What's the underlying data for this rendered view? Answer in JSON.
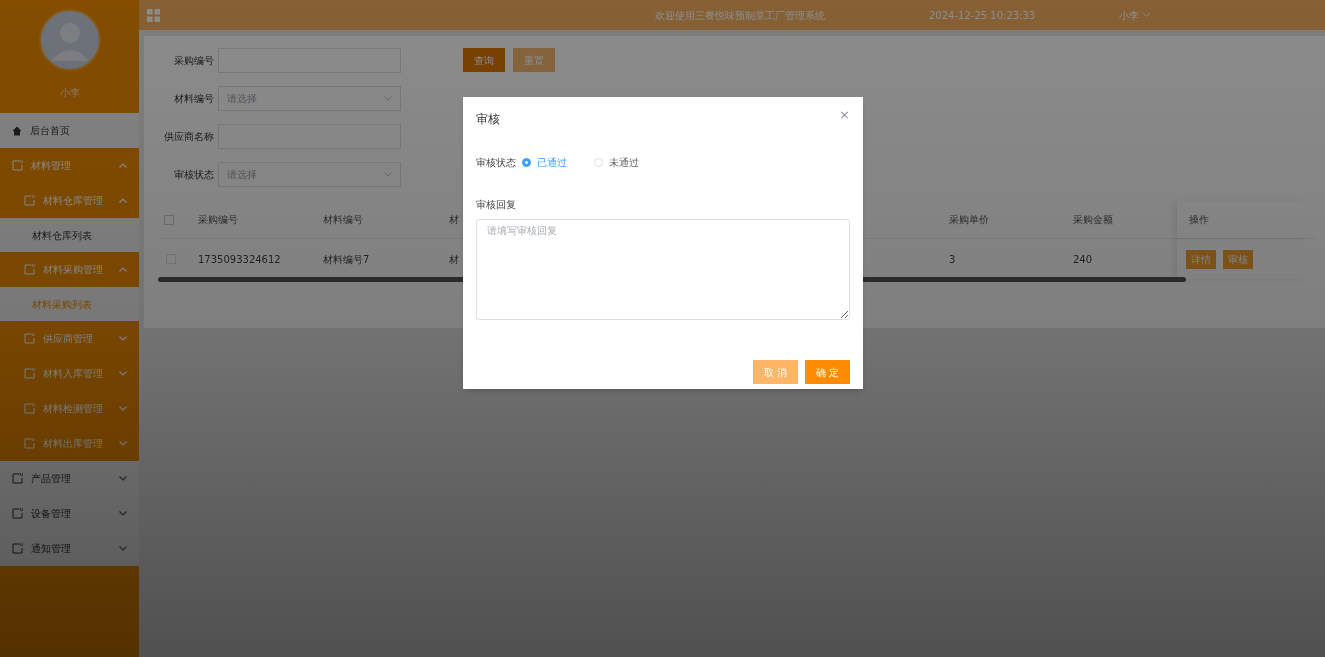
{
  "header": {
    "title": "欢迎使用三餐悦味预制菜工厂管理系统",
    "datetime": "2024-12-25 10:23:33",
    "user": "小李"
  },
  "sidebar": {
    "user_name": "小李",
    "items": [
      {
        "kind": "home",
        "label": "后台首页",
        "selected": false
      },
      {
        "kind": "group",
        "label": "材料管理",
        "expanded": true,
        "children": [
          {
            "kind": "group",
            "label": "材料仓库管理",
            "expanded": true,
            "children": [
              {
                "kind": "leaf",
                "label": "材料仓库列表",
                "selected": false
              }
            ]
          },
          {
            "kind": "group",
            "label": "材料采购管理",
            "expanded": true,
            "children": [
              {
                "kind": "leaf",
                "label": "材料采购列表",
                "selected": true
              }
            ]
          },
          {
            "kind": "group",
            "label": "供应商管理",
            "expanded": false
          },
          {
            "kind": "group",
            "label": "材料入库管理",
            "expanded": false
          },
          {
            "kind": "group",
            "label": "材料检测管理",
            "expanded": false
          },
          {
            "kind": "group",
            "label": "材料出库管理",
            "expanded": false
          }
        ]
      },
      {
        "kind": "group",
        "label": "产品管理",
        "expanded": false
      },
      {
        "kind": "group",
        "label": "设备管理",
        "expanded": false
      },
      {
        "kind": "group",
        "label": "通知管理",
        "expanded": false
      }
    ]
  },
  "filters": [
    {
      "kind": "input",
      "label": "采购编号"
    },
    {
      "kind": "select",
      "label": "材料编号",
      "placeholder": "请选择"
    },
    {
      "kind": "input",
      "label": "供应商名称"
    },
    {
      "kind": "select",
      "label": "审核状态",
      "placeholder": "请选择"
    }
  ],
  "filter_buttons": [
    {
      "kind": "primary",
      "label": "查询"
    },
    {
      "kind": "secondary",
      "label": "重置"
    }
  ],
  "table": {
    "header_checked": false,
    "columns": [
      "采购编号",
      "材料编号",
      "材",
      "采购单价",
      "采购金额",
      "操作"
    ],
    "rows": [
      {
        "checked": false,
        "cells": [
          "1735093324612",
          "材料编号7",
          "材",
          "3",
          "240"
        ],
        "actions": [
          "详情",
          "审核"
        ]
      }
    ]
  },
  "dialog": {
    "title": "审核",
    "close": "×",
    "status_label": "审核状态",
    "options": [
      {
        "label": "已通过",
        "selected": true
      },
      {
        "label": "未通过",
        "selected": false
      }
    ],
    "reply_label": "审核回复",
    "reply_placeholder": "请填写审核回复",
    "buttons": [
      {
        "kind": "cancel",
        "label": "取 消"
      },
      {
        "kind": "confirm",
        "label": "确 定"
      }
    ]
  }
}
